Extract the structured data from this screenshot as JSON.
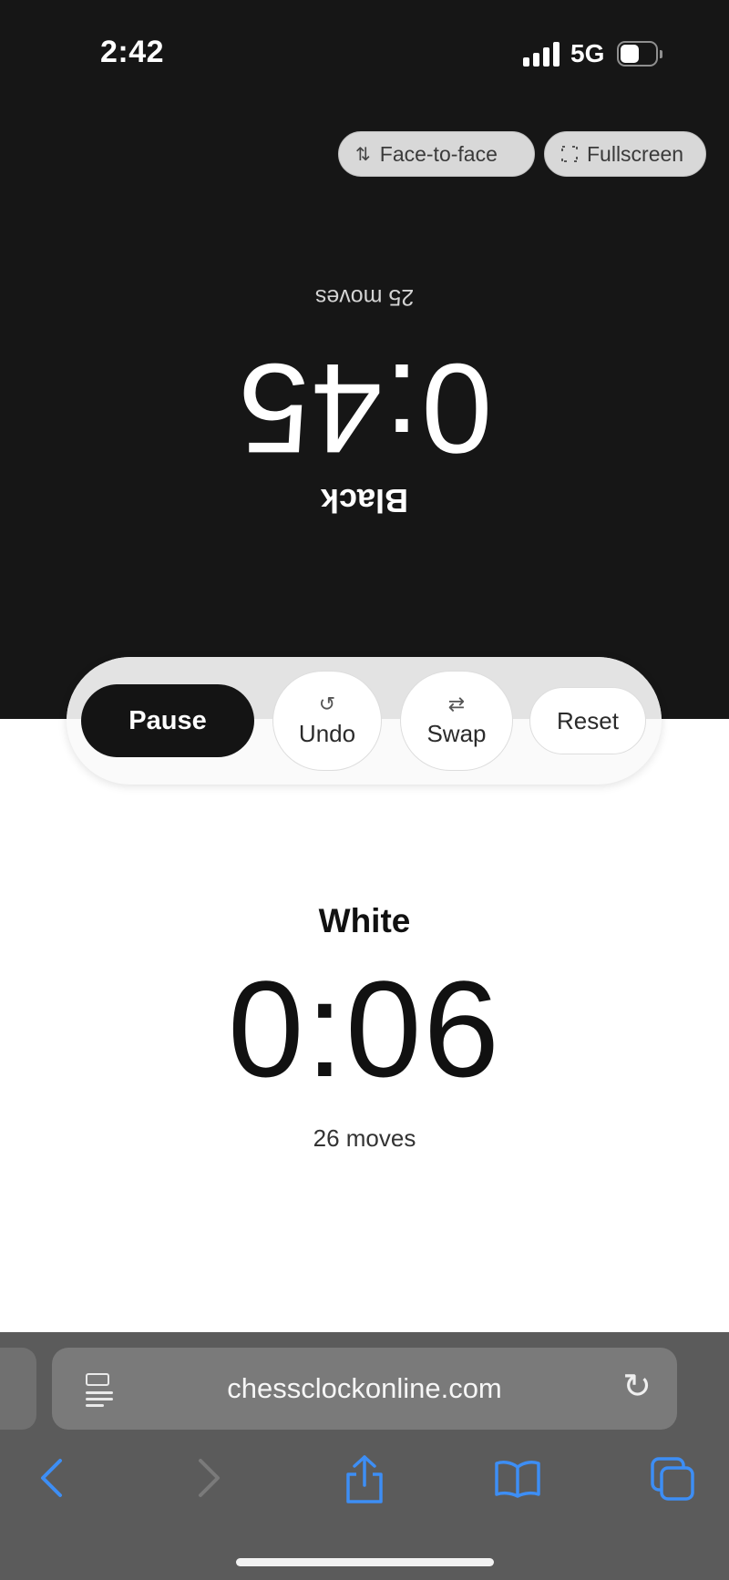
{
  "status_bar": {
    "time": "2:42",
    "network": "5G",
    "signal_bars": 4,
    "battery_level": 0.45
  },
  "top_controls": {
    "face_to_face_label": "Face-to-face",
    "fullscreen_label": "Fullscreen"
  },
  "black": {
    "name": "Black",
    "clock": "0:45",
    "moves": "25 moves"
  },
  "controls": {
    "pause_label": "Pause",
    "undo_label": "Undo",
    "swap_label": "Swap",
    "reset_label": "Reset"
  },
  "white": {
    "name": "White",
    "clock": "0:06",
    "moves": "26 moves"
  },
  "browser": {
    "url": "chessclockonline.com"
  },
  "icons": {
    "face_to_face": "arrows-up-down-icon",
    "fullscreen": "fullscreen-icon",
    "undo": "undo-icon",
    "swap": "swap-arrows-icon",
    "reader": "reader-icon",
    "reload": "reload-icon",
    "back": "back-chevron-icon",
    "forward": "forward-chevron-icon",
    "share": "share-icon",
    "bookmarks": "bookmarks-icon",
    "tabs": "tabs-icon"
  },
  "colors": {
    "top_background": "#161616",
    "accent_blue": "#3d8ef5",
    "browser_background": "#5b5b5b"
  }
}
